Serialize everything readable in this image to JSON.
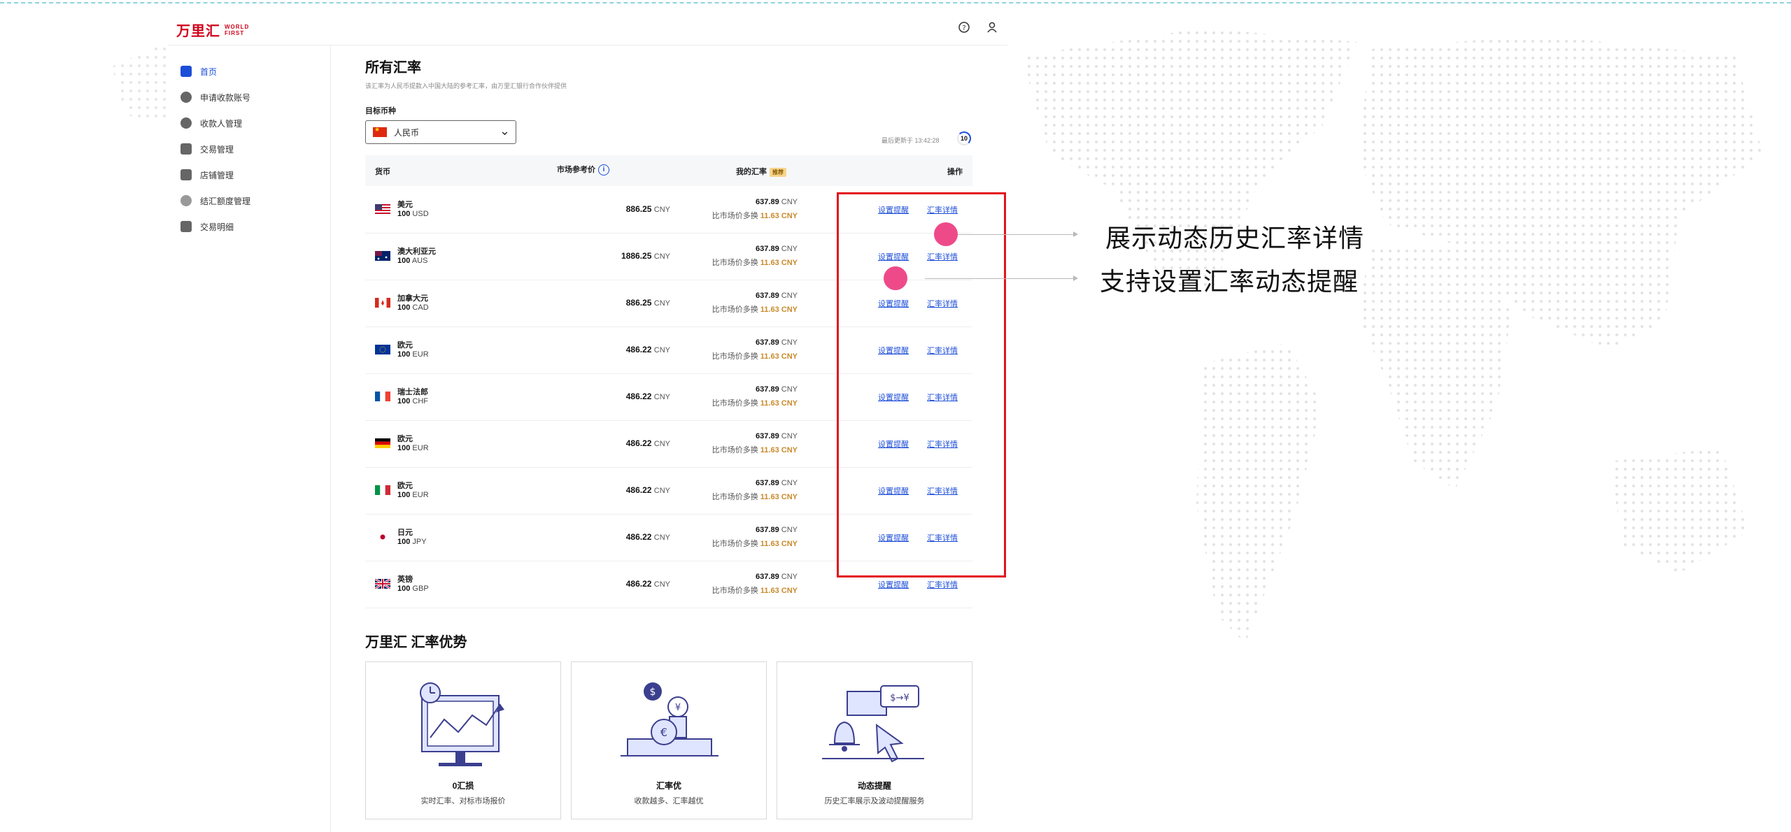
{
  "app": {
    "logo_cn": "万里汇",
    "logo_en_1": "WORLD",
    "logo_en_2": "FIRST"
  },
  "header": {
    "help_icon": "help-circle-icon",
    "user_icon": "user-icon"
  },
  "sidebar": {
    "items": [
      {
        "label": "首页",
        "icon": "home-icon",
        "active": true
      },
      {
        "label": "申请收款账号",
        "icon": "account-icon"
      },
      {
        "label": "收款人管理",
        "icon": "payee-icon"
      },
      {
        "label": "交易管理",
        "icon": "transaction-icon"
      },
      {
        "label": "店铺管理",
        "icon": "store-icon"
      },
      {
        "label": "结汇额度管理",
        "icon": "quota-icon"
      },
      {
        "label": "交易明细",
        "icon": "details-icon"
      }
    ]
  },
  "main": {
    "title": "所有汇率",
    "subtitle": "该汇率为人民币提款入中国大陆的参考汇率，由万里汇银行合作伙伴提供",
    "target_label": "目标币种",
    "target_value": "人民币",
    "updated_text": "最后更新于 13:42:28",
    "timer_value": "10"
  },
  "table": {
    "headers": {
      "currency": "货币",
      "market": "市场参考价",
      "mine": "我的汇率",
      "mine_badge": "推荐",
      "action": "操作"
    },
    "action_alert": "设置提醒",
    "action_detail": "汇率详情",
    "more_text": "比市场价多换",
    "rows": [
      {
        "flag": "us",
        "name": "美元",
        "amount": "100",
        "code": "USD",
        "market": "886.25",
        "market_unit": "CNY",
        "mine": "637.89",
        "mine_unit": "CNY",
        "gain": "11.63 CNY"
      },
      {
        "flag": "au",
        "name": "澳大利亚元",
        "amount": "100",
        "code": "AUS",
        "market": "1886.25",
        "market_unit": "CNY",
        "mine": "637.89",
        "mine_unit": "CNY",
        "gain": "11.63 CNY"
      },
      {
        "flag": "ca",
        "name": "加拿大元",
        "amount": "100",
        "code": "CAD",
        "market": "886.25",
        "market_unit": "CNY",
        "mine": "637.89",
        "mine_unit": "CNY",
        "gain": "11.63 CNY"
      },
      {
        "flag": "eu",
        "name": "欧元",
        "amount": "100",
        "code": "EUR",
        "market": "486.22",
        "market_unit": "CNY",
        "mine": "637.89",
        "mine_unit": "CNY",
        "gain": "11.63 CNY"
      },
      {
        "flag": "fr",
        "name": "瑞士法郎",
        "amount": "100",
        "code": "CHF",
        "market": "486.22",
        "market_unit": "CNY",
        "mine": "637.89",
        "mine_unit": "CNY",
        "gain": "11.63 CNY"
      },
      {
        "flag": "de",
        "name": "欧元",
        "amount": "100",
        "code": "EUR",
        "market": "486.22",
        "market_unit": "CNY",
        "mine": "637.89",
        "mine_unit": "CNY",
        "gain": "11.63 CNY"
      },
      {
        "flag": "it",
        "name": "欧元",
        "amount": "100",
        "code": "EUR",
        "market": "486.22",
        "market_unit": "CNY",
        "mine": "637.89",
        "mine_unit": "CNY",
        "gain": "11.63 CNY"
      },
      {
        "flag": "jp",
        "name": "日元",
        "amount": "100",
        "code": "JPY",
        "market": "486.22",
        "market_unit": "CNY",
        "mine": "637.89",
        "mine_unit": "CNY",
        "gain": "11.63 CNY"
      },
      {
        "flag": "gb",
        "name": "英镑",
        "amount": "100",
        "code": "GBP",
        "market": "486.22",
        "market_unit": "CNY",
        "mine": "637.89",
        "mine_unit": "CNY",
        "gain": "11.63 CNY"
      }
    ]
  },
  "advantages": {
    "title": "万里汇 汇率优势",
    "cards": [
      {
        "title": "0汇损",
        "subtitle": "实时汇率、对标市场报价"
      },
      {
        "title": "汇率优",
        "subtitle": "收款越多、汇率越优"
      },
      {
        "title": "动态提醒",
        "subtitle": "历史汇率展示及波动提醒服务"
      }
    ],
    "exchange_glyph": "$→¥"
  },
  "annotations": {
    "line1": "展示动态历史汇率详情",
    "line2": "支持设置汇率动态提醒"
  },
  "colors": {
    "brand_red": "#d0021b",
    "link_blue": "#1d4ed8",
    "highlight_red": "#e3141c",
    "marker_pink": "#ee4a8a",
    "gain_gold": "#c98a2b"
  }
}
